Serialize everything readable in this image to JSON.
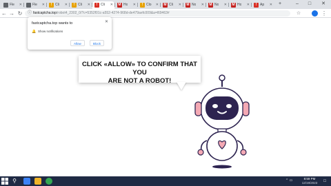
{
  "tabs": [
    {
      "title": "Fle",
      "favicon": "file-icon",
      "color": "#5f6368"
    },
    {
      "title": "Fle",
      "favicon": "file-icon",
      "color": "#5f6368"
    },
    {
      "title": "Cli",
      "favicon": "warning-icon",
      "color": "#e8a200"
    },
    {
      "title": "Cli",
      "favicon": "warning-icon",
      "color": "#e8a200"
    },
    {
      "title": "Cli",
      "favicon": "warning-icon",
      "color": "#d93025",
      "active": true
    },
    {
      "title": "Ho",
      "favicon": "red-m-icon",
      "color": "#c5221f"
    },
    {
      "title": "Clo",
      "favicon": "warning-icon",
      "color": "#e8a200"
    },
    {
      "title": "Cli",
      "favicon": "red-m-icon",
      "color": "#c5221f"
    },
    {
      "title": "No",
      "favicon": "red-m-icon",
      "color": "#c5221f"
    },
    {
      "title": "No",
      "favicon": "red-m-icon",
      "color": "#c5221f"
    },
    {
      "title": "Ho",
      "favicon": "red-m-icon",
      "color": "#c5221f"
    },
    {
      "title": "Ap",
      "favicon": "warning-icon",
      "color": "#d93025"
    }
  ],
  "address": {
    "host": "fastcaptcha.top",
    "path": "/robot4_2302_0/?c=5352f01c-a552-4274-968d-de479aefc009&a=l69463#"
  },
  "permission_popup": {
    "title": "fastcaptcha.top wants to",
    "item": "Show notifications",
    "allow_label": "Allow",
    "block_label": "Block"
  },
  "bubble": {
    "line1": "CLICK «ALLOW» TO CONFIRM THAT YOU",
    "line2": "ARE NOT A ROBOT!"
  },
  "taskbar": {
    "time": "8:59 PM",
    "date": "12/19/2023"
  },
  "colors": {
    "accent": "#1a73e8",
    "robot_accent": "#f4a9b4",
    "robot_body": "#ffffff",
    "robot_visor": "#2d2350",
    "taskbar": "#1f2a44"
  }
}
